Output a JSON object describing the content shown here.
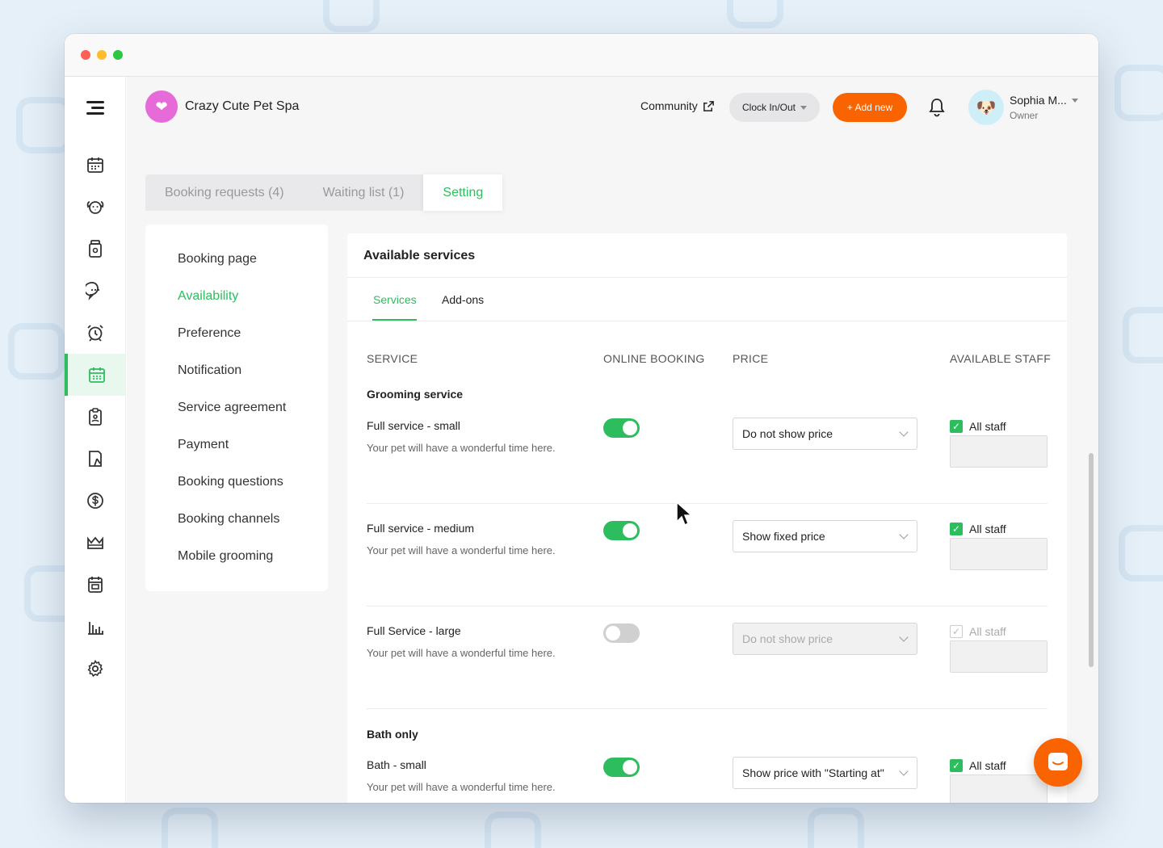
{
  "brand": {
    "name": "Crazy Cute Pet Spa",
    "logo": "pet-spa-logo"
  },
  "header": {
    "community_label": "Community",
    "clock_label": "Clock In/Out",
    "add_label": "+ Add new",
    "user_name": "Sophia M...",
    "user_role": "Owner"
  },
  "sidebar": {
    "icons": [
      "calendar-icon",
      "pet-face-icon",
      "jar-icon",
      "chat-icon",
      "alarm-clock-icon",
      "online-booking-icon",
      "clipboard-icon",
      "report-card-icon",
      "dollar-icon",
      "crown-icon",
      "calendar-grid-icon",
      "bar-chart-icon",
      "gear-icon"
    ],
    "active_index": 5
  },
  "tabs": [
    "Booking requests (4)",
    "Waiting list (1)",
    "Setting"
  ],
  "active_tab": "Setting",
  "settings_menu": [
    "Booking page",
    "Availability",
    "Preference",
    "Notification",
    "Service agreement",
    "Payment",
    "Booking questions",
    "Booking channels",
    "Mobile grooming"
  ],
  "settings_active": "Availability",
  "panel": {
    "title": "Available services",
    "subtabs": [
      "Services",
      "Add-ons"
    ],
    "columns": [
      "SERVICE",
      "ONLINE BOOKING",
      "PRICE",
      "AVAILABLE STAFF"
    ]
  },
  "groups": [
    {
      "title": "Grooming service",
      "services": [
        {
          "name": "Full service - small",
          "desc": "Your pet will have a wonderful time here.",
          "online": true,
          "price": "Do not show price",
          "staff": "All staff"
        },
        {
          "name": "Full service - medium",
          "desc": "Your pet will have a wonderful time here.",
          "online": true,
          "price": "Show fixed price",
          "staff": "All staff"
        },
        {
          "name": "Full Service - large",
          "desc": "Your pet will have a wonderful time here.",
          "online": false,
          "price": "Do not show price",
          "staff": "All staff"
        }
      ]
    },
    {
      "title": "Bath only",
      "services": [
        {
          "name": "Bath - small",
          "desc": "Your pet will have a wonderful time here.",
          "online": true,
          "price": "Show price with \"Starting at\"",
          "staff": "All staff"
        }
      ]
    }
  ],
  "colors": {
    "accent": "#2dbd5e",
    "brand_orange": "#f96300"
  }
}
